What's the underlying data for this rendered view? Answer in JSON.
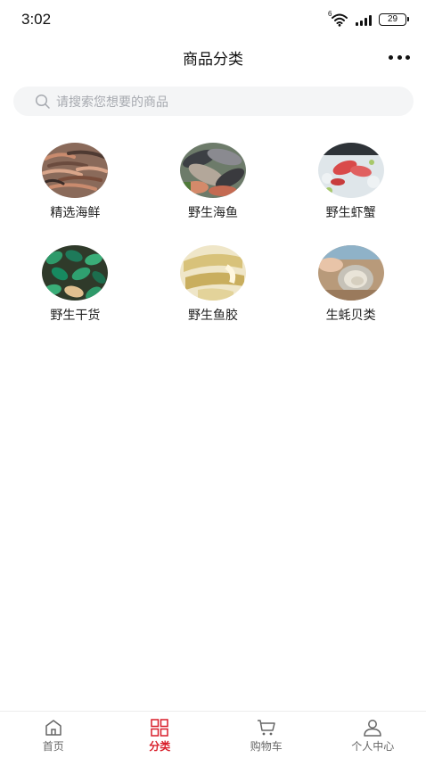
{
  "status_bar": {
    "time": "3:02",
    "network_label": "6",
    "battery": "29"
  },
  "header": {
    "title": "商品分类"
  },
  "search": {
    "placeholder": "请搜索您想要的商品"
  },
  "categories": [
    {
      "label": "精选海鲜"
    },
    {
      "label": "野生海鱼"
    },
    {
      "label": "野生虾蟹"
    },
    {
      "label": "野生干货"
    },
    {
      "label": "野生鱼胶"
    },
    {
      "label": "生蚝贝类"
    }
  ],
  "tabbar": {
    "active_color": "#d81e2a",
    "items": [
      {
        "label": "首页",
        "icon": "home-icon"
      },
      {
        "label": "分类",
        "icon": "category-grid-icon"
      },
      {
        "label": "购物车",
        "icon": "cart-icon"
      },
      {
        "label": "个人中心",
        "icon": "user-icon"
      }
    ]
  }
}
